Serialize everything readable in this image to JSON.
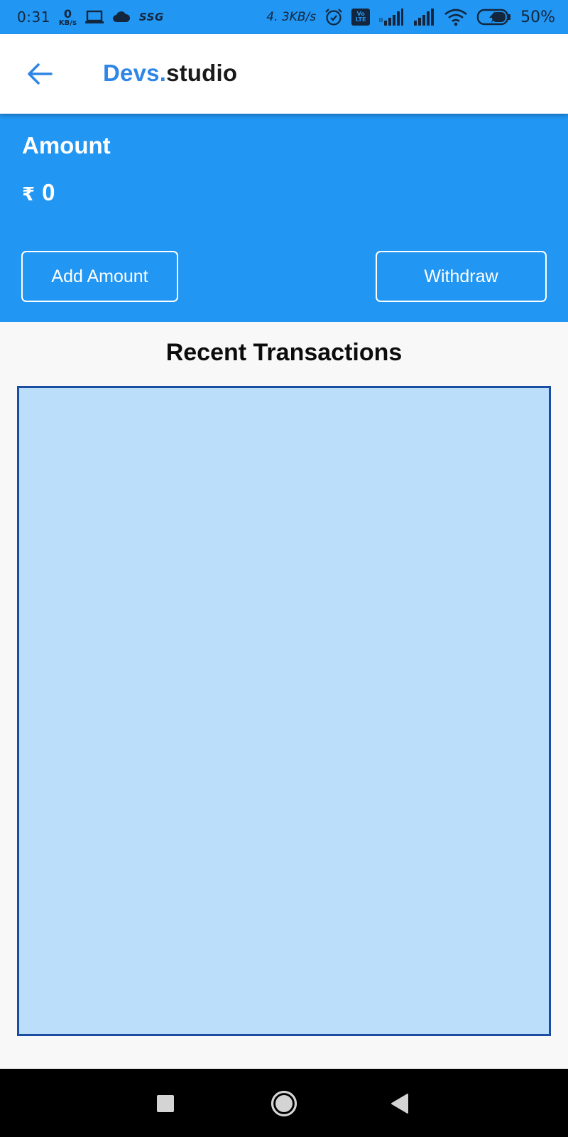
{
  "status_bar": {
    "time": "0:31",
    "net_speed_value": "0",
    "net_speed_unit": "KB/s",
    "carrier_tag": "SSG",
    "data_rate": "4. 3KB/s",
    "volte_top": "Vo",
    "volte_bottom": "LTE",
    "battery_percent": "50%",
    "icons": [
      "laptop-icon",
      "cloud-icon",
      "alarm-icon",
      "volte-icon",
      "signal-4g-icon",
      "signal-icon",
      "wifi-icon",
      "battery-charging-icon"
    ]
  },
  "app_bar": {
    "title_brand": "Devs.",
    "title_suffix": "studio",
    "back_icon": "arrow-left-icon"
  },
  "wallet": {
    "label": "Amount",
    "currency_symbol": "₹",
    "amount": "0",
    "add_button": "Add Amount",
    "withdraw_button": "Withdraw"
  },
  "transactions": {
    "title": "Recent Transactions"
  },
  "nav_bar": {
    "icons": [
      "recents-square-icon",
      "home-circle-icon",
      "back-triangle-icon"
    ]
  },
  "colors": {
    "primary": "#2196f3",
    "brand_text": "#2f86e6",
    "panel_fill": "#bbdefa",
    "panel_border": "#1b4ea3",
    "background": "#f8f8f8"
  }
}
